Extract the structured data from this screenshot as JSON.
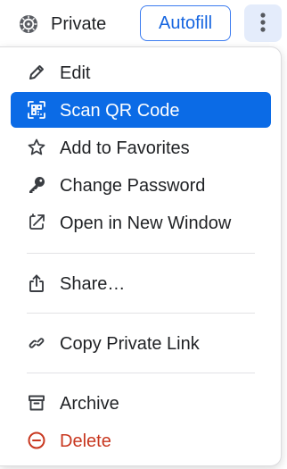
{
  "header": {
    "vault_label": "Private",
    "autofill_label": "Autofill",
    "vault_icon": "vault-icon",
    "more_icon": "more-vertical-icon"
  },
  "menu": {
    "items": [
      {
        "label": "Edit",
        "icon": "pencil-icon"
      },
      {
        "label": "Scan QR Code",
        "icon": "qr-scan-icon",
        "active": true
      },
      {
        "label": "Add to Favorites",
        "icon": "star-icon"
      },
      {
        "label": "Change Password",
        "icon": "key-icon"
      },
      {
        "label": "Open in New Window",
        "icon": "open-window-icon"
      },
      {
        "label": "Share…",
        "icon": "share-icon"
      },
      {
        "label": "Copy Private Link",
        "icon": "link-icon"
      },
      {
        "label": "Archive",
        "icon": "archive-icon"
      },
      {
        "label": "Delete",
        "icon": "delete-icon",
        "danger": true
      }
    ]
  },
  "colors": {
    "accent": "#0b6be6",
    "autofill_text": "#1565e0",
    "danger": "#c8371f",
    "more_button_bg": "#e4ecfb",
    "text": "#1f2124"
  }
}
